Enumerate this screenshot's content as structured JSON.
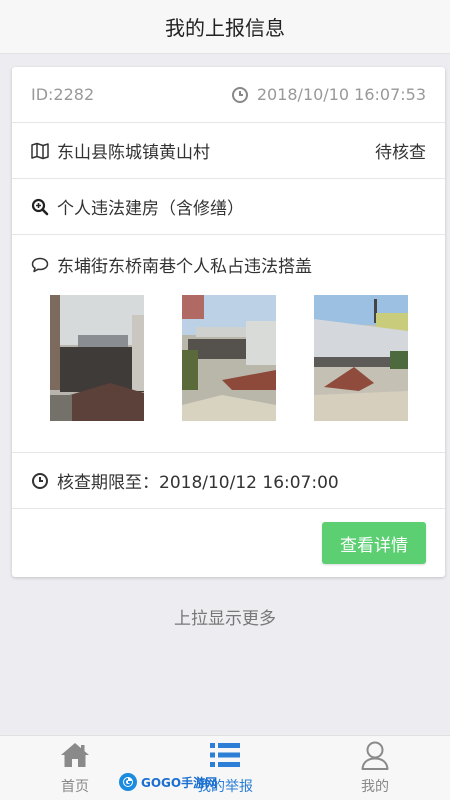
{
  "header": {
    "title": "我的上报信息"
  },
  "report": {
    "id": "ID:2282",
    "time": "2018/10/10 16:07:53",
    "location": "东山县陈城镇黄山村",
    "status": "待核查",
    "category": "个人违法建房（含修缮）",
    "description": "东埔街东桥南巷个人私占违法搭盖",
    "deadline": "核查期限至：2018/10/12 16:07:00",
    "detail_button": "查看详情"
  },
  "load_more": "上拉显示更多",
  "tabbar": {
    "items": [
      {
        "label": "首页",
        "icon": "home-icon"
      },
      {
        "label": "我的举报",
        "icon": "list-icon",
        "active": true
      },
      {
        "label": "我的",
        "icon": "user-icon"
      }
    ]
  },
  "watermark": {
    "text": "GOGO手游网"
  },
  "colors": {
    "accent": "#5ccf73",
    "tab_active": "#2c7ed6"
  }
}
